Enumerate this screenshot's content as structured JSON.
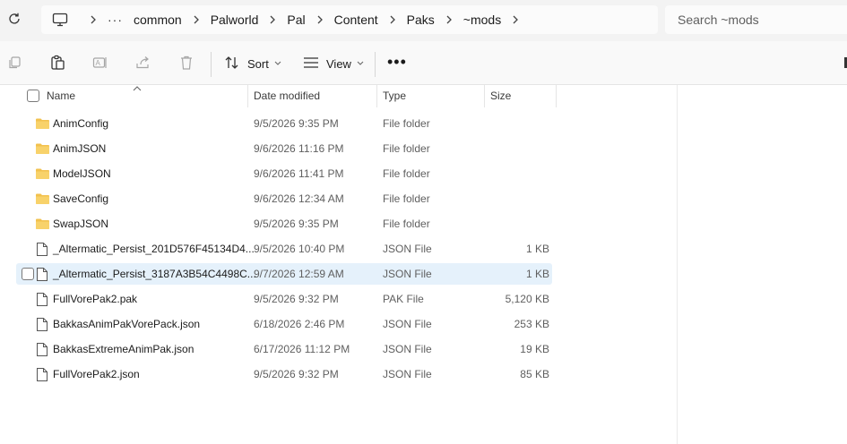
{
  "breadcrumbs": [
    "common",
    "Palworld",
    "Pal",
    "Content",
    "Paks",
    "~mods"
  ],
  "search": {
    "placeholder": "Search ~mods"
  },
  "toolbar": {
    "sort_label": "Sort",
    "view_label": "View"
  },
  "columns": {
    "name": "Name",
    "date": "Date modified",
    "type": "Type",
    "size": "Size"
  },
  "files": [
    {
      "name": "AnimConfig",
      "date": "9/5/2026 9:35 PM",
      "type": "File folder",
      "size": "",
      "icon": "folder-icon"
    },
    {
      "name": "AnimJSON",
      "date": "9/6/2026 11:16 PM",
      "type": "File folder",
      "size": "",
      "icon": "folder-icon"
    },
    {
      "name": "ModelJSON",
      "date": "9/6/2026 11:41 PM",
      "type": "File folder",
      "size": "",
      "icon": "folder-icon"
    },
    {
      "name": "SaveConfig",
      "date": "9/6/2026 12:34 AM",
      "type": "File folder",
      "size": "",
      "icon": "folder-icon"
    },
    {
      "name": "SwapJSON",
      "date": "9/5/2026 9:35 PM",
      "type": "File folder",
      "size": "",
      "icon": "folder-icon"
    },
    {
      "name": "_Altermatic_Persist_201D576F45134D4...",
      "date": "9/5/2026 10:40 PM",
      "type": "JSON File",
      "size": "1 KB",
      "icon": "file-icon"
    },
    {
      "name": "_Altermatic_Persist_3187A3B54C4498C...",
      "date": "9/7/2026 12:59 AM",
      "type": "JSON File",
      "size": "1 KB",
      "icon": "file-icon"
    },
    {
      "name": "FullVorePak2.pak",
      "date": "9/5/2026 9:32 PM",
      "type": "PAK File",
      "size": "5,120 KB",
      "icon": "file-icon"
    },
    {
      "name": "BakkasAnimPakVorePack.json",
      "date": "6/18/2026 2:46 PM",
      "type": "JSON File",
      "size": "253 KB",
      "icon": "file-icon"
    },
    {
      "name": "BakkasExtremeAnimPak.json",
      "date": "6/17/2026 11:12 PM",
      "type": "JSON File",
      "size": "19 KB",
      "icon": "file-icon"
    },
    {
      "name": "FullVorePak2.json",
      "date": "9/5/2026 9:32 PM",
      "type": "JSON File",
      "size": "85 KB",
      "icon": "file-icon"
    }
  ],
  "colors": {
    "accent_selection": "#e5f1fb",
    "folder": "#f2c14e",
    "folder_dark": "#e3a82b"
  }
}
